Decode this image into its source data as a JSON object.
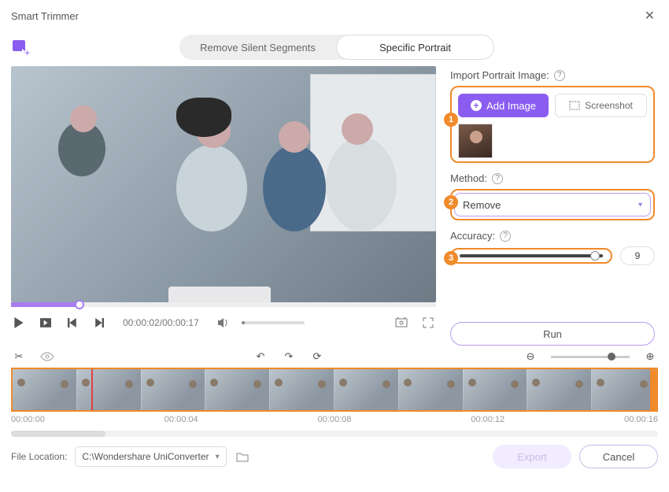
{
  "title": "Smart Trimmer",
  "tabs": {
    "silent": "Remove Silent Segments",
    "portrait": "Specific Portrait"
  },
  "playback": {
    "current": "00:00:02",
    "total": "00:00:17"
  },
  "sidebar": {
    "import_label": "Import Portrait Image:",
    "add_image": "Add Image",
    "screenshot": "Screenshot",
    "method_label": "Method:",
    "method_value": "Remove",
    "accuracy_label": "Accuracy:",
    "accuracy_value": "9",
    "run": "Run"
  },
  "callouts": {
    "one": "1",
    "two": "2",
    "three": "3"
  },
  "timecodes": [
    "00:00:00",
    "00:00:04",
    "00:00:08",
    "00:00:12",
    "00:00:16"
  ],
  "footer": {
    "location_label": "File Location:",
    "location_path": "C:\\Wondershare UniConverter",
    "export": "Export",
    "cancel": "Cancel"
  }
}
